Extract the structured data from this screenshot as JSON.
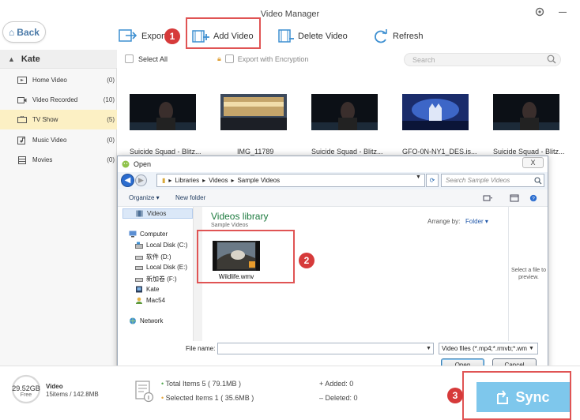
{
  "app": {
    "title": "Video Manager",
    "back_label": "Back"
  },
  "toolbar": {
    "export": "Export",
    "add_video": "Add Video",
    "delete_video": "Delete Video",
    "refresh": "Refresh"
  },
  "annotations": {
    "step1": "1",
    "step2": "2",
    "step3": "3"
  },
  "sidebar": {
    "device": "Kate",
    "items": [
      {
        "label": "Home Video",
        "count": "(0)",
        "icon": "home-video-icon"
      },
      {
        "label": "Video Recorded",
        "count": "(10)",
        "icon": "camera-icon"
      },
      {
        "label": "TV Show",
        "count": "(5)",
        "icon": "tv-icon"
      },
      {
        "label": "Music Video",
        "count": "(0)",
        "icon": "music-video-icon"
      },
      {
        "label": "Movies",
        "count": "(0)",
        "icon": "film-icon"
      }
    ]
  },
  "content": {
    "select_all": "Select All",
    "export_encryption": "Export with Encryption",
    "search_placeholder": "Search",
    "videos": [
      {
        "label": "Suicide Squad - Blitz..."
      },
      {
        "label": "IMG_11789"
      },
      {
        "label": "Suicide Squad - Blitz..."
      },
      {
        "label": "GFO-0N-NY1_DES.is..."
      },
      {
        "label": "Suicide Squad - Blitz..."
      }
    ]
  },
  "dialog": {
    "title": "Open",
    "close": "X",
    "path": [
      "Libraries",
      "Videos",
      "Sample Videos"
    ],
    "search_placeholder": "Search Sample Videos",
    "organize": "Organize ▾",
    "new_folder": "New folder",
    "nav": {
      "videos": "Videos",
      "computer": "Computer",
      "drives": [
        "Local Disk (C:)",
        "软件 (D:)",
        "Local Disk (E:)",
        "新加卷 (F:)"
      ],
      "kate": "Kate",
      "mac": "Mac54",
      "network": "Network"
    },
    "library_title": "Videos library",
    "library_sub": "Sample Videos",
    "arrange_by": "Arrange by:",
    "arrange_value": "Folder ▾",
    "file": "Wildlife.wmv",
    "preview_text": "Select a file to preview.",
    "file_name_label": "File name:",
    "file_type": "Video files (*.mp4;*.rmvb;*.wm",
    "open": "Open",
    "cancel": "Cancel"
  },
  "footer": {
    "storage_amount": "29.52GB",
    "storage_free": "Free",
    "storage_type": "Video",
    "storage_info": "15items / 142.8MB",
    "total_items": "Total Items 5 ( 79.1MB )",
    "selected_items": "Selected Items 1 ( 35.6MB )",
    "added": "Added: 0",
    "deleted": "Deleted: 0",
    "sync": "Sync"
  },
  "colors": {
    "accent": "#4a7aa8",
    "sync": "#7ec7ec",
    "annotation": "#d63a3a",
    "active_row": "#fcf0c4"
  }
}
